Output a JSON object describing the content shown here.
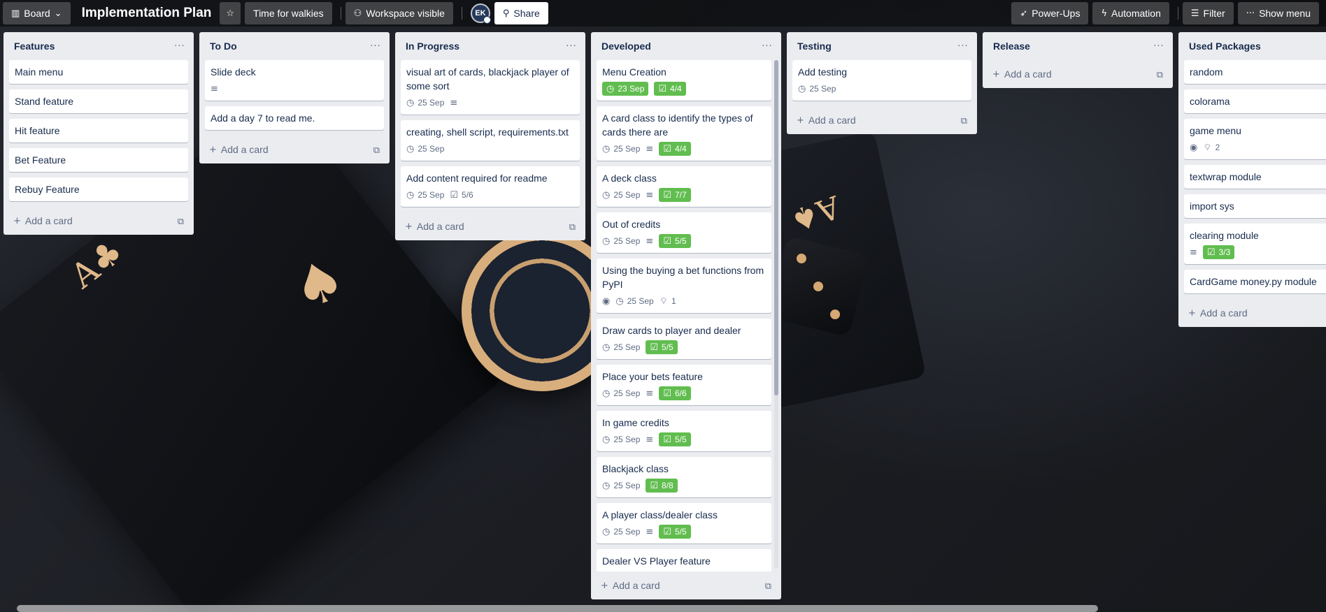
{
  "topbar": {
    "view_label": "Board",
    "board_title": "Implementation Plan",
    "workspace_name": "Time for walkies",
    "visibility_label": "Workspace visible",
    "avatar_initials": "EK",
    "share_label": "Share",
    "powerups_label": "Power-Ups",
    "automation_label": "Automation",
    "filter_label": "Filter",
    "show_menu_label": "Show menu"
  },
  "common": {
    "add_card_label": "Add a card"
  },
  "lists": [
    {
      "title": "Features",
      "cards": [
        {
          "title": "Main menu"
        },
        {
          "title": "Stand feature"
        },
        {
          "title": "Hit feature"
        },
        {
          "title": "Bet Feature"
        },
        {
          "title": "Rebuy Feature"
        }
      ]
    },
    {
      "title": "To Do",
      "cards": [
        {
          "title": "Slide deck",
          "description": true
        },
        {
          "title": "Add a day 7 to read me."
        }
      ]
    },
    {
      "title": "In Progress",
      "cards": [
        {
          "title": "visual art of cards, blackjack player of some sort",
          "due": "25 Sep",
          "description": true
        },
        {
          "title": "creating, shell script, requirements.txt",
          "due": "25 Sep"
        },
        {
          "title": "Add content required for readme",
          "due": "25 Sep",
          "checklist": "5/6",
          "checklist_complete": false
        }
      ]
    },
    {
      "title": "Developed",
      "cards": [
        {
          "title": "Menu Creation",
          "due": "23 Sep",
          "due_complete": true,
          "checklist": "4/4",
          "checklist_complete": true
        },
        {
          "title": "A card class to identify the types of cards there are",
          "due": "25 Sep",
          "description": true,
          "checklist": "4/4",
          "checklist_complete": true
        },
        {
          "title": "A deck class",
          "due": "25 Sep",
          "description": true,
          "checklist": "7/7",
          "checklist_complete": true
        },
        {
          "title": "Out of credits",
          "due": "25 Sep",
          "description": true,
          "checklist": "5/5",
          "checklist_complete": true
        },
        {
          "title": "Using the buying a bet functions from PyPI",
          "watching": true,
          "due": "25 Sep",
          "comments": "1"
        },
        {
          "title": "Draw cards to player and dealer",
          "due": "25 Sep",
          "checklist": "5/5",
          "checklist_complete": true
        },
        {
          "title": "Place your bets feature",
          "due": "25 Sep",
          "description": true,
          "checklist": "6/6",
          "checklist_complete": true
        },
        {
          "title": "In game credits",
          "due": "25 Sep",
          "description": true,
          "checklist": "5/5",
          "checklist_complete": true
        },
        {
          "title": "Blackjack class",
          "due": "25 Sep",
          "checklist": "8/8",
          "checklist_complete": true
        },
        {
          "title": "A player class/dealer class",
          "due": "25 Sep",
          "description": true,
          "checklist": "5/5",
          "checklist_complete": true
        },
        {
          "title": "Dealer VS Player feature"
        }
      ]
    },
    {
      "title": "Testing",
      "cards": [
        {
          "title": "Add testing",
          "due": "25 Sep"
        }
      ]
    },
    {
      "title": "Release",
      "cards": []
    },
    {
      "title": "Used Packages",
      "cards": [
        {
          "title": "random"
        },
        {
          "title": "colorama"
        },
        {
          "title": "game menu",
          "watching": true,
          "comments": "2"
        },
        {
          "title": "textwrap module"
        },
        {
          "title": "import sys"
        },
        {
          "title": "clearing module",
          "description": true,
          "checklist": "3/3",
          "checklist_complete": true
        },
        {
          "title": "CardGame money.py module"
        }
      ]
    }
  ],
  "colors": {
    "complete_green": "#61bd4f",
    "list_bg": "#ebecf0",
    "text": "#172b4d",
    "muted": "#5e6c84"
  }
}
